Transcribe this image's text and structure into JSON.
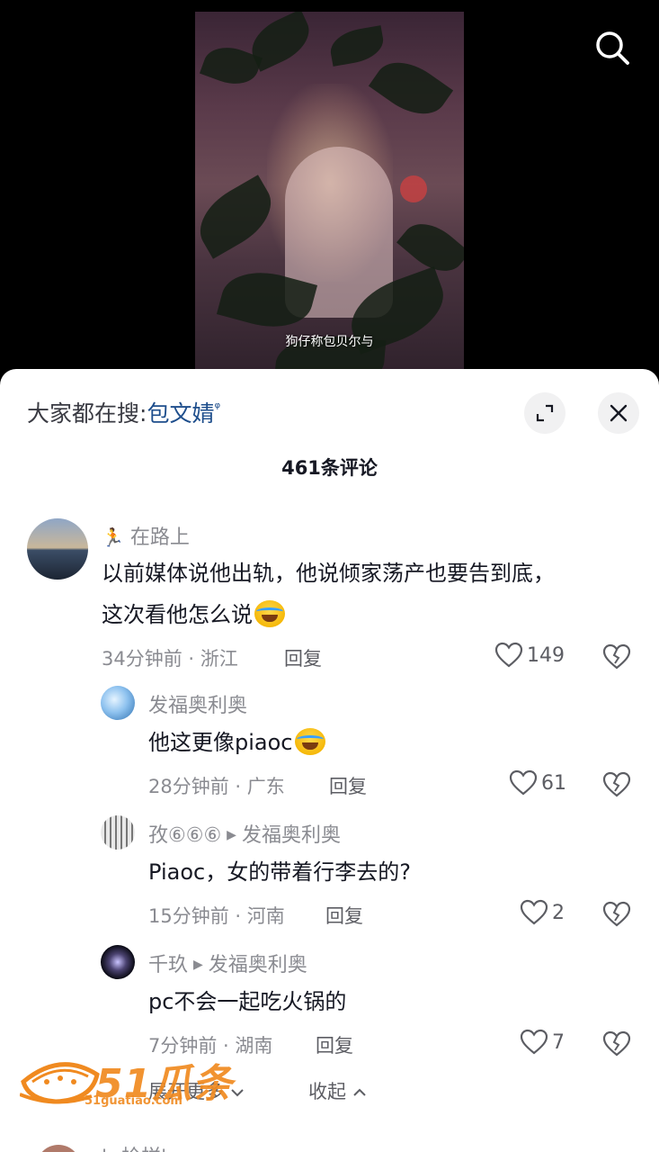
{
  "video": {
    "subtitle": "狗仔称包贝尔与",
    "search_icon": "search-icon"
  },
  "panel": {
    "search_hint_label": "大家都在搜:",
    "search_hint_keyword": "包文婧",
    "count_label": "461条评论",
    "expand_icon": "expand-icon",
    "close_icon": "close-icon"
  },
  "comments": [
    {
      "user": "在路上",
      "text_line1": "以前媒体说他出轨，他说倾家荡产也要告到底，",
      "text_line2": "这次看他怎么说",
      "time_location": "34分钟前 · 浙江",
      "reply_label": "回复",
      "likes": "149"
    },
    {
      "user": "发福奥利奥",
      "text": "他这更像piaoc",
      "time_location": "28分钟前 · 广东",
      "reply_label": "回复",
      "likes": "61"
    },
    {
      "user": "孜⑥⑥⑥",
      "reply_to": "发福奥利奥",
      "text": "Piaoc，女的带着行李去的?",
      "time_location": "15分钟前 · 河南",
      "reply_label": "回复",
      "likes": "2"
    },
    {
      "user": "千玖",
      "reply_to": "发福奥利奥",
      "text": "pc不会一起吃火锅的",
      "time_location": "7分钟前 · 湖南",
      "reply_label": "回复",
      "likes": "7"
    }
  ],
  "actions": {
    "expand_more": "展开更多",
    "collapse": "收起"
  },
  "watermark": {
    "logo_text": "51瓜条",
    "url": "51guatiao.com"
  },
  "next_comment": {
    "user_partial": "'∧检样'"
  },
  "colors": {
    "keyword": "#1e4e8c",
    "secondary_text": "#8a8b91",
    "primary_text": "#161823",
    "watermark": "#f08a20"
  }
}
